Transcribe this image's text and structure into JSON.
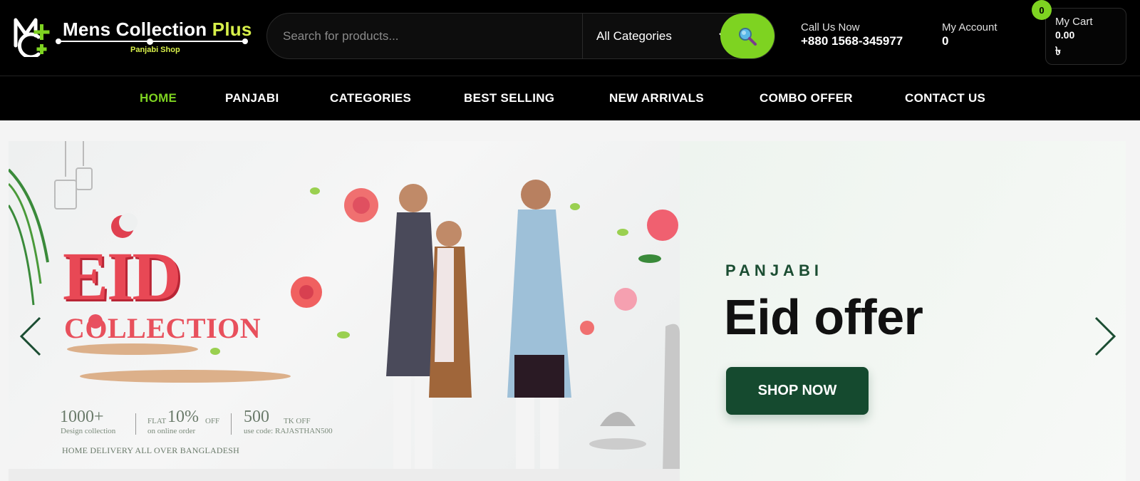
{
  "brand": {
    "name_main": "Mens Collection ",
    "name_accent": "Plus",
    "tagline": "Panjabi Shop"
  },
  "search": {
    "placeholder": "Search for products...",
    "category_selected": "All Categories"
  },
  "header": {
    "call_label": "Call Us Now",
    "call_number": "+880 1568-345977",
    "account_label": "My Account",
    "account_count": "0",
    "cart_label": "My Cart",
    "cart_amount": "0.00",
    "cart_currency": "৳",
    "cart_badge": "0"
  },
  "nav": {
    "items": [
      {
        "label": "HOME"
      },
      {
        "label": "PANJABI"
      },
      {
        "label": "CATEGORIES"
      },
      {
        "label": "BEST SELLING"
      },
      {
        "label": "NEW ARRIVALS"
      },
      {
        "label": "COMBO OFFER"
      },
      {
        "label": "CONTACT US"
      }
    ]
  },
  "hero": {
    "tag": "PANJABI",
    "title": "Eid offer",
    "cta": "SHOP NOW",
    "banner": {
      "eid": "EID",
      "collection": "COLLECTION",
      "stat1_num": "1000+",
      "stat1_sub": "Design collection",
      "stat2_pre": "FLAT",
      "stat2_num": "10%",
      "stat2_post": "OFF",
      "stat2_sub": "on online order",
      "stat3_num": "500",
      "stat3_post": "TK OFF",
      "stat3_sub": "use code: RAJASTHAN500",
      "delivery": "HOME DELIVERY ALL OVER BANGLADESH"
    }
  },
  "colors": {
    "accent_green": "#7ed321",
    "dark_green": "#154a2f",
    "header_bg": "#000000"
  },
  "icons": {
    "search": "magnifier-icon",
    "chevron": "chevron-down-icon",
    "prev": "chevron-left-icon",
    "next": "chevron-right-icon"
  }
}
